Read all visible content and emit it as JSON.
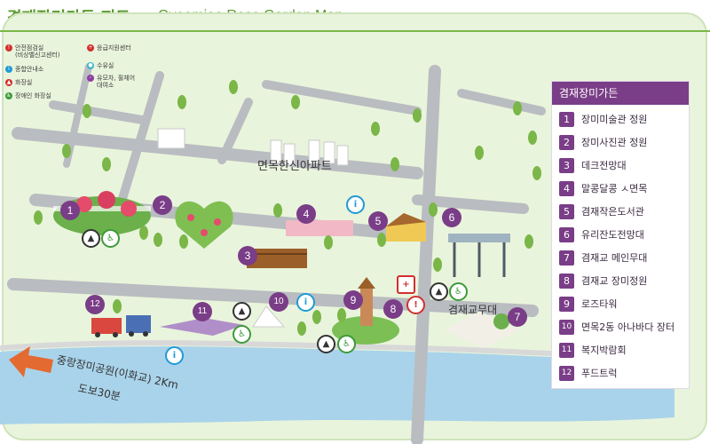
{
  "header": {
    "title_kr": "겸재장미가든 지도",
    "title_en": "Gyeomjae Rose Garden Map"
  },
  "legend": {
    "items": [
      {
        "icon": "alert-icon",
        "color": "#d2302f",
        "text": "안전점검실\n(비상벨신고센터)"
      },
      {
        "icon": "info-icon",
        "color": "#1f9ad6",
        "text": "종합안내소"
      },
      {
        "icon": "restroom-icon",
        "color": "#d2302f",
        "text": "화장실"
      },
      {
        "icon": "accessible-restroom-icon",
        "color": "#3d9a3a",
        "text": "장애인 화장실"
      },
      {
        "icon": "first-aid-icon",
        "color": "#d2302f",
        "text": "응급지원센터"
      },
      {
        "icon": "water-icon",
        "color": "#38b4c8",
        "text": "수유실"
      },
      {
        "icon": "stroller-icon",
        "color": "#8b3fa0",
        "text": "유모차, 휠체어\n대여소"
      }
    ]
  },
  "map": {
    "apartment_label": "면목한신아파트",
    "stage_label": "겸재교무대",
    "direction_line1": "중랑장미공원(이화교) 2Km",
    "direction_line2": "도보30분",
    "markers": [
      "1",
      "2",
      "3",
      "4",
      "5",
      "6",
      "7",
      "8",
      "9",
      "10",
      "11",
      "12"
    ]
  },
  "panel": {
    "title": "겸재장미가든",
    "items": [
      {
        "num": "1",
        "label": "장미미술관 정원"
      },
      {
        "num": "2",
        "label": "장미사진관 정원"
      },
      {
        "num": "3",
        "label": "데크전망대"
      },
      {
        "num": "4",
        "label": "말콩달콩 ㅅ면목"
      },
      {
        "num": "5",
        "label": "겸재작은도서관"
      },
      {
        "num": "6",
        "label": "유리잔도전망대"
      },
      {
        "num": "7",
        "label": "겸재교 메인무대"
      },
      {
        "num": "8",
        "label": "겸재교 장미정원"
      },
      {
        "num": "9",
        "label": "로즈타워"
      },
      {
        "num": "10",
        "label": "면목2동 아나바다 장터"
      },
      {
        "num": "11",
        "label": "복지박람회"
      },
      {
        "num": "12",
        "label": "푸드트럭"
      }
    ]
  },
  "colors": {
    "brand_green": "#5a9a2e",
    "panel_purple": "#7a3d87",
    "river": "#a9d3ea",
    "road": "#b9bcc0"
  }
}
